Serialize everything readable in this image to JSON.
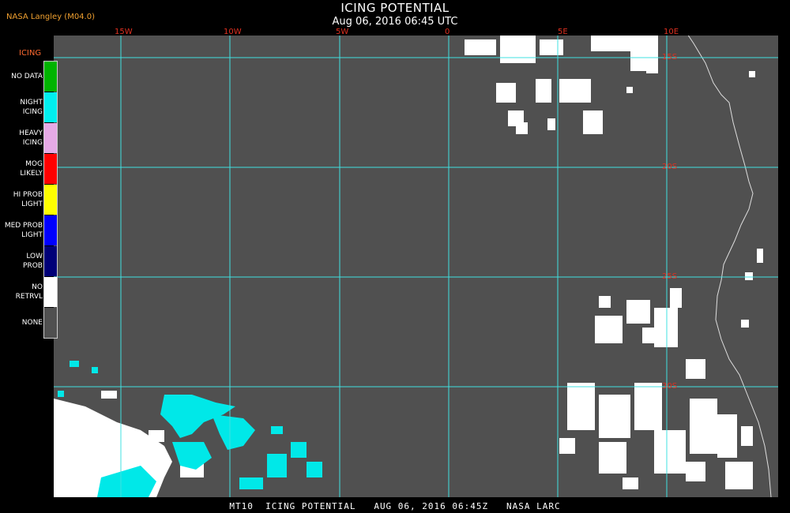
{
  "header": {
    "title": "ICING POTENTIAL",
    "subtitle": "Aug 06, 2016 06:45 UTC",
    "producer": "NASA Langley (M04.0)"
  },
  "legend": {
    "title": "ICING",
    "items": [
      {
        "label1": "NO DATA",
        "label2": "",
        "color": "#00b400"
      },
      {
        "label1": "NIGHT",
        "label2": "ICING",
        "color": "#00f0f0"
      },
      {
        "label1": "HEAVY",
        "label2": "ICING",
        "color": "#e6aae6"
      },
      {
        "label1": "MOG",
        "label2": "LIKELY",
        "color": "#ff0000"
      },
      {
        "label1": "HI PROB",
        "label2": "LIGHT",
        "color": "#ffff00"
      },
      {
        "label1": "MED PROB",
        "label2": "LIGHT",
        "color": "#0000ff"
      },
      {
        "label1": "LOW",
        "label2": "PROB",
        "color": "#000078"
      },
      {
        "label1": "NO",
        "label2": "RETRVL",
        "color": "#ffffff"
      },
      {
        "label1": "NONE",
        "label2": "",
        "color": "#505050"
      }
    ]
  },
  "map": {
    "background_color": "#505050",
    "grid_color": "#40e0e0",
    "label_color": "#e03020",
    "longitude_labels": [
      "15W",
      "10W",
      "5W",
      "0",
      "5E",
      "10E"
    ],
    "latitude_labels": [
      "15S",
      "20S",
      "25S",
      "30S"
    ]
  },
  "footer": {
    "text": "MT10  ICING POTENTIAL   AUG 06, 2016 06:45Z   NASA LARC"
  }
}
